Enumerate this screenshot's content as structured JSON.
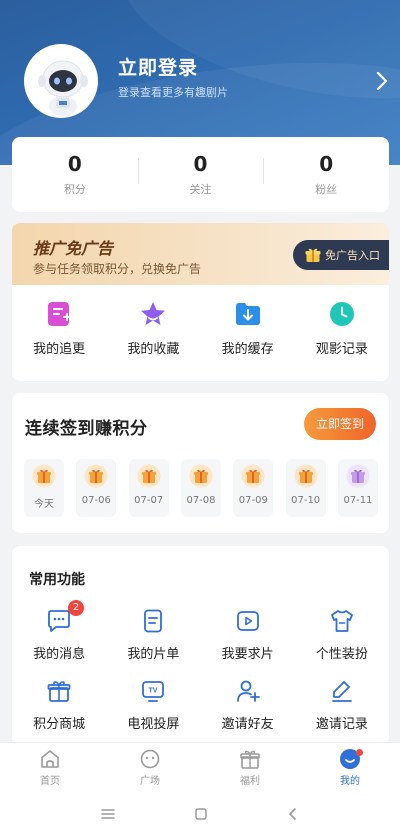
{
  "header": {
    "login_title": "立即登录",
    "login_subtitle": "登录查看更多有趣剧片"
  },
  "stats": [
    {
      "value": "0",
      "label": "积分"
    },
    {
      "value": "0",
      "label": "关注"
    },
    {
      "value": "0",
      "label": "粉丝"
    }
  ],
  "promo": {
    "title": "推广免广告",
    "subtitle": "参与任务领取积分，兑换免广告",
    "button": "免广告入口"
  },
  "quick_actions": [
    {
      "label": "我的追更",
      "icon": "follow-updates-icon",
      "color": "#d94fd4"
    },
    {
      "label": "我的收藏",
      "icon": "star-icon",
      "color": "#8f5cf0"
    },
    {
      "label": "我的缓存",
      "icon": "download-icon",
      "color": "#2c8fe8"
    },
    {
      "label": "观影记录",
      "icon": "clock-icon",
      "color": "#1fc7b8"
    }
  ],
  "signin": {
    "title": "连续签到赚积分",
    "button": "立即签到",
    "days": [
      "今天",
      "07-06",
      "07-07",
      "07-08",
      "07-09",
      "07-10",
      "07-11"
    ]
  },
  "features": {
    "title": "常用功能",
    "items": [
      {
        "label": "我的消息",
        "icon": "message-icon",
        "badge": "2"
      },
      {
        "label": "我的片单",
        "icon": "playlist-icon"
      },
      {
        "label": "我要求片",
        "icon": "request-video-icon"
      },
      {
        "label": "个性装扮",
        "icon": "shirt-icon"
      },
      {
        "label": "积分商城",
        "icon": "gift-box-icon"
      },
      {
        "label": "电视投屏",
        "icon": "tv-icon"
      },
      {
        "label": "邀请好友",
        "icon": "add-user-icon"
      },
      {
        "label": "邀请记录",
        "icon": "edit-record-icon"
      }
    ],
    "icon_color": "#2f6fd8"
  },
  "tabbar": [
    {
      "label": "首页",
      "icon": "home-icon"
    },
    {
      "label": "广场",
      "icon": "plaza-icon"
    },
    {
      "label": "福利",
      "icon": "gift-icon"
    },
    {
      "label": "我的",
      "icon": "profile-icon",
      "active": true
    }
  ],
  "colors": {
    "header": "#2f6bb0",
    "accent": "#2f6fd8",
    "signin_button": "#f0652a",
    "promo_bg": "#f3d6ad",
    "badge": "#f0453a"
  }
}
